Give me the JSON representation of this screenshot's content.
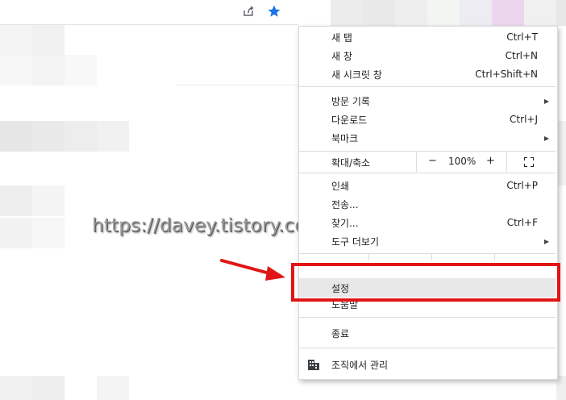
{
  "watermark": "https://davey.tistory.com/",
  "toolbar": {
    "share_icon": "share-icon",
    "bookmark_icon": "star-icon",
    "star_color": "#1a73e8"
  },
  "menu": {
    "new_tab": {
      "label": "새 탭",
      "shortcut": "Ctrl+T"
    },
    "new_window": {
      "label": "새 창",
      "shortcut": "Ctrl+N"
    },
    "incognito": {
      "label": "새 시크릿 창",
      "shortcut": "Ctrl+Shift+N"
    },
    "history": {
      "label": "방문 기록"
    },
    "downloads": {
      "label": "다운로드",
      "shortcut": "Ctrl+J"
    },
    "bookmarks": {
      "label": "북마크"
    },
    "zoom": {
      "label": "확대/축소",
      "minus": "−",
      "value": "100%",
      "plus": "+"
    },
    "print": {
      "label": "인쇄",
      "shortcut": "Ctrl+P"
    },
    "cast": {
      "label": "전송..."
    },
    "find": {
      "label": "찾기...",
      "shortcut": "Ctrl+F"
    },
    "more_tools": {
      "label": "도구 더보기"
    },
    "settings": {
      "label": "설정"
    },
    "help": {
      "label": "도움말"
    },
    "exit": {
      "label": "종료"
    },
    "managed": {
      "label": "조직에서 관리"
    }
  },
  "colors": {
    "highlight": "#e8e8e8",
    "annotation_red": "#e01515"
  }
}
